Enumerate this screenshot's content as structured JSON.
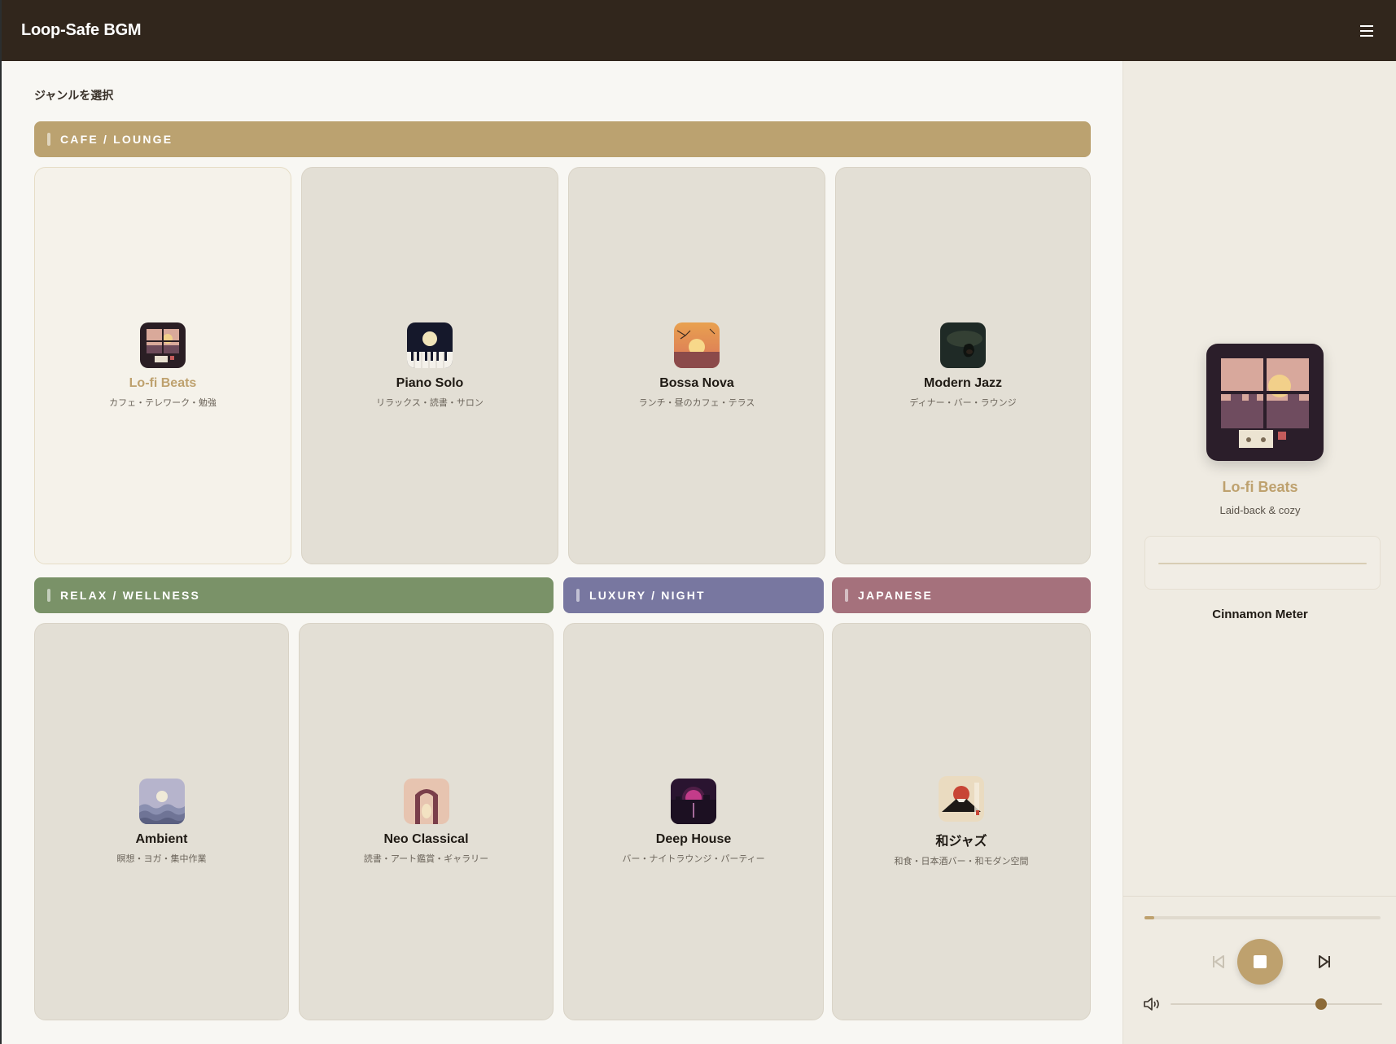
{
  "app": {
    "title": "Loop-Safe BGM"
  },
  "main": {
    "heading": "ジャンルを選択"
  },
  "categories": [
    {
      "label": "CAFE / LOUNGE",
      "color": "#bba270"
    },
    {
      "label": "RELAX / WELLNESS",
      "color": "#7a9268"
    },
    {
      "label": "LUXURY / NIGHT",
      "color": "#7877a0"
    },
    {
      "label": "JAPANESE",
      "color": "#a5717c"
    }
  ],
  "genres": [
    {
      "name": "Lo-fi Beats",
      "desc": "カフェ・テレワーク・勉強",
      "icon": "lofi-window-icon",
      "active": true
    },
    {
      "name": "Piano Solo",
      "desc": "リラックス・読書・サロン",
      "icon": "piano-moon-icon"
    },
    {
      "name": "Bossa Nova",
      "desc": "ランチ・昼のカフェ・テラス",
      "icon": "sunset-palm-icon"
    },
    {
      "name": "Modern Jazz",
      "desc": "ディナー・バー・ラウンジ",
      "icon": "jazz-night-icon"
    },
    {
      "name": "Ambient",
      "desc": "瞑想・ヨガ・集中作業",
      "icon": "moon-waves-icon"
    },
    {
      "name": "Neo Classical",
      "desc": "読書・アート鑑賞・ギャラリー",
      "icon": "arch-icon"
    },
    {
      "name": "Deep House",
      "desc": "バー・ナイトラウンジ・パーティー",
      "icon": "city-sunset-icon"
    },
    {
      "name": "和ジャズ",
      "desc": "和食・日本酒バー・和モダン空間",
      "icon": "mount-fuji-icon"
    }
  ],
  "now_playing": {
    "title": "Lo-fi Beats",
    "subtitle": "Laid-back & cozy",
    "meter_label": "Cinnamon Meter",
    "progress": 0.04,
    "volume": 0.71,
    "accent": "#bea16e"
  }
}
